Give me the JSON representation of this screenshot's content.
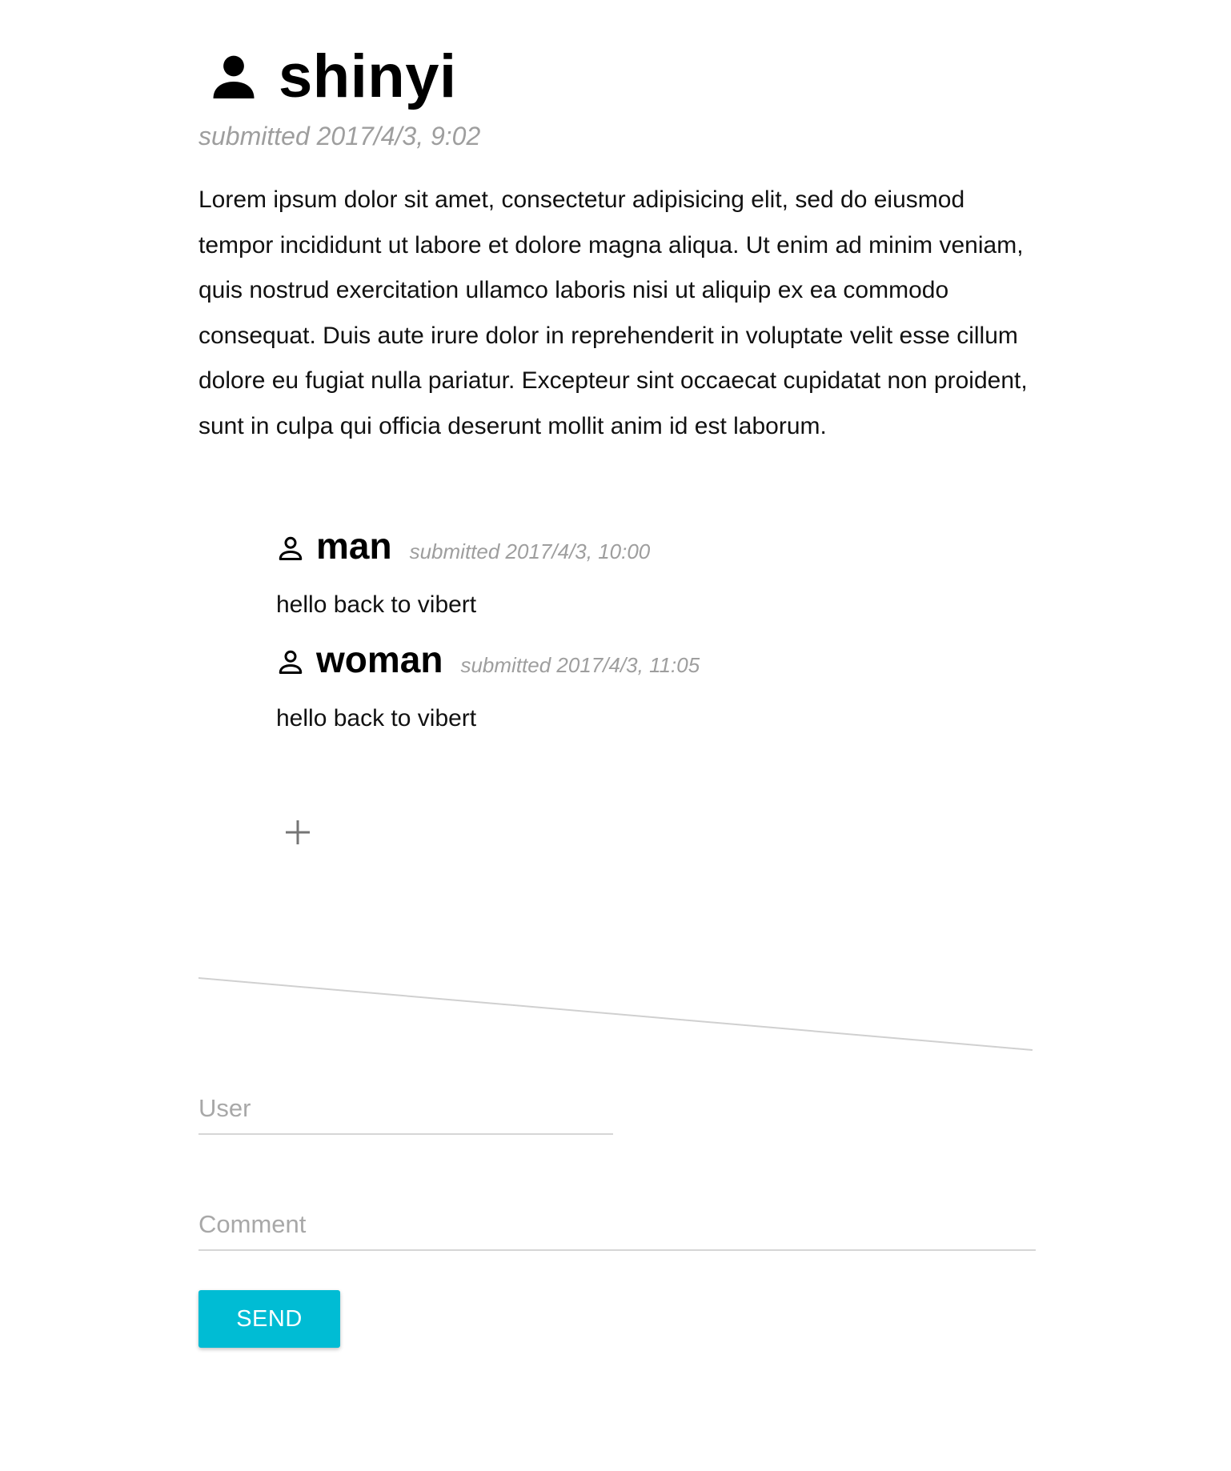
{
  "post": {
    "author": "shinyi",
    "submitted": "submitted 2017/4/3, 9:02",
    "body": "Lorem ipsum dolor sit amet, consectetur adipisicing elit, sed do eiusmod tempor incididunt ut labore et dolore magna aliqua. Ut enim ad minim veniam, quis nostrud exercitation ullamco laboris nisi ut aliquip ex ea commodo consequat. Duis aute irure dolor in reprehenderit in voluptate velit esse cillum dolore eu fugiat nulla pariatur. Excepteur sint occaecat cupidatat non proident, sunt in culpa qui officia deserunt mollit anim id est laborum.",
    "icon": "person-icon"
  },
  "comments": [
    {
      "author": "man",
      "submitted": "submitted 2017/4/3, 10:00",
      "text": "hello back to vibert",
      "icon": "person-outline-icon"
    },
    {
      "author": "woman",
      "submitted": "submitted 2017/4/3, 11:05",
      "text": "hello back to vibert",
      "icon": "person-outline-icon"
    }
  ],
  "add_comment": {
    "icon": "plus-icon"
  },
  "form": {
    "user_placeholder": "User",
    "comment_placeholder": "Comment",
    "send_label": "SEND"
  },
  "colors": {
    "accent": "#00bcd4",
    "meta_text": "#9e9e9e",
    "divider": "#d6d6d6"
  }
}
